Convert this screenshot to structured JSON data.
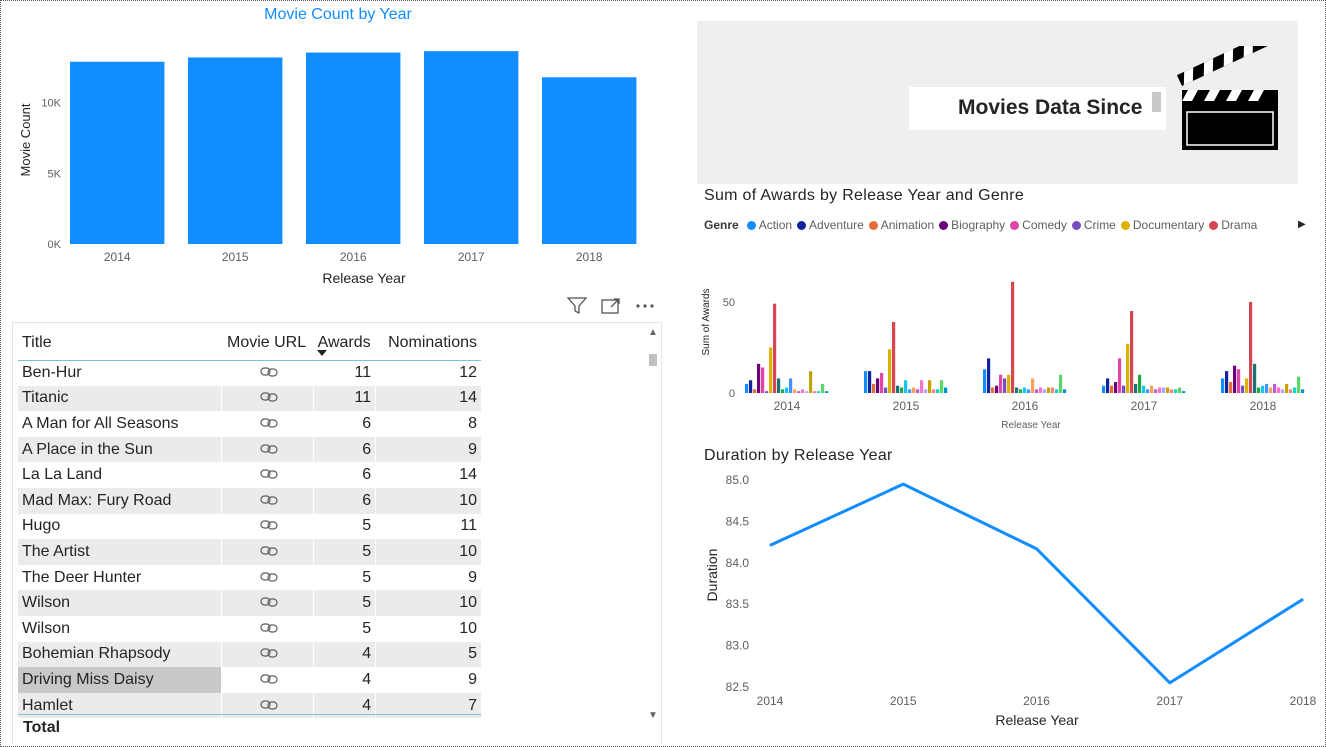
{
  "bar_chart": {
    "title": "Movie Count by Year",
    "xlabel": "Release Year",
    "ylabel": "Movie Count",
    "accent": "#118dff"
  },
  "banner": {
    "text": "Movies Data Since",
    "icon": "clapperboard-icon"
  },
  "awards_chart": {
    "title": "Sum of Awards by Release Year and Genre",
    "legend_label": "Genre",
    "ylabel": "Sum of Awards",
    "xlabel": "Release Year"
  },
  "line_chart": {
    "title": "Duration by Release Year",
    "xlabel": "Release Year",
    "ylabel": "Duration",
    "accent": "#118dff"
  },
  "visual_header": {
    "icons": [
      "filter-icon",
      "focus-mode-icon",
      "more-options-icon"
    ]
  },
  "table": {
    "headers": [
      "Title",
      "Movie URL",
      "Awards",
      "Nominations"
    ],
    "rows": [
      {
        "title": "Ben-Hur",
        "awards": "11",
        "nominations": "12"
      },
      {
        "title": "Titanic",
        "awards": "11",
        "nominations": "14"
      },
      {
        "title": "A Man for All Seasons",
        "awards": "6",
        "nominations": "8"
      },
      {
        "title": "A Place in the Sun",
        "awards": "6",
        "nominations": "9"
      },
      {
        "title": "La La Land",
        "awards": "6",
        "nominations": "14"
      },
      {
        "title": "Mad Max: Fury Road",
        "awards": "6",
        "nominations": "10"
      },
      {
        "title": "Hugo",
        "awards": "5",
        "nominations": "11"
      },
      {
        "title": "The Artist",
        "awards": "5",
        "nominations": "10"
      },
      {
        "title": "The Deer Hunter",
        "awards": "5",
        "nominations": "9"
      },
      {
        "title": "Wilson",
        "awards": "5",
        "nominations": "10"
      },
      {
        "title": "Wilson",
        "awards": "5",
        "nominations": "10"
      },
      {
        "title": "Bohemian Rhapsody",
        "awards": "4",
        "nominations": "5"
      },
      {
        "title": "Driving Miss Daisy",
        "awards": "4",
        "nominations": "9"
      },
      {
        "title": "Hamlet",
        "awards": "4",
        "nominations": "7"
      }
    ],
    "url_icon": "link-icon",
    "total_label": "Total",
    "selected_row": 12
  },
  "chart_data": [
    {
      "type": "bar",
      "title": "Movie Count by Year",
      "xlabel": "Release Year",
      "ylabel": "Movie Count",
      "categories": [
        "2014",
        "2015",
        "2016",
        "2017",
        "2018"
      ],
      "values": [
        12900,
        13200,
        13550,
        13650,
        11800
      ],
      "yticks": [
        "0K",
        "5K",
        "10K"
      ],
      "ylim": [
        0,
        15500
      ],
      "grid": false
    },
    {
      "type": "bar",
      "title": "Sum of Awards by Release Year and Genre",
      "xlabel": "Release Year",
      "ylabel": "Sum of Awards",
      "categories": [
        "2014",
        "2015",
        "2016",
        "2017",
        "2018"
      ],
      "yticks": [
        "0",
        "50"
      ],
      "ylim": [
        0,
        62
      ],
      "legend_position": "top-left",
      "series": [
        {
          "name": "Action",
          "color": "#118dff",
          "values": [
            5,
            12,
            13,
            4,
            8
          ]
        },
        {
          "name": "Adventure",
          "color": "#12239e",
          "values": [
            7,
            12,
            19,
            8,
            12
          ]
        },
        {
          "name": "Animation",
          "color": "#e66c37",
          "values": [
            2,
            5,
            3,
            4,
            6
          ]
        },
        {
          "name": "Biography",
          "color": "#6b007b",
          "values": [
            16,
            8,
            4,
            6,
            15
          ]
        },
        {
          "name": "Comedy",
          "color": "#e044a7",
          "values": [
            14,
            11,
            10,
            19,
            13
          ]
        },
        {
          "name": "Crime",
          "color": "#744ec2",
          "values": [
            1,
            3,
            8,
            4,
            4
          ]
        },
        {
          "name": "Documentary",
          "color": "#d9b300",
          "values": [
            25,
            24,
            10,
            27,
            8
          ]
        },
        {
          "name": "Drama",
          "color": "#d64550",
          "values": [
            49,
            39,
            61,
            45,
            50
          ]
        },
        {
          "name": "",
          "color": "#197278",
          "values": [
            8,
            4,
            3,
            5,
            16
          ]
        },
        {
          "name": "",
          "color": "#1aab40",
          "values": [
            2,
            3,
            2,
            10,
            3
          ]
        },
        {
          "name": "",
          "color": "#15c6f4",
          "values": [
            3,
            7,
            3,
            4,
            4
          ]
        },
        {
          "name": "",
          "color": "#4092ff",
          "values": [
            8,
            2,
            2,
            2,
            5
          ]
        },
        {
          "name": "",
          "color": "#ffa058",
          "values": [
            2,
            3,
            8,
            4,
            3
          ]
        },
        {
          "name": "",
          "color": "#be5dc9",
          "values": [
            1,
            2,
            2,
            2,
            5
          ]
        },
        {
          "name": "",
          "color": "#f472d0",
          "values": [
            2,
            7,
            3,
            3,
            3
          ]
        },
        {
          "name": "",
          "color": "#b5a1ff",
          "values": [
            1,
            2,
            2,
            3,
            2
          ]
        },
        {
          "name": "",
          "color": "#c4a200",
          "values": [
            12,
            7,
            3,
            3,
            5
          ]
        },
        {
          "name": "",
          "color": "#ff8080",
          "values": [
            1,
            2,
            3,
            2,
            2
          ]
        },
        {
          "name": "",
          "color": "#00dbbc",
          "values": [
            1,
            2,
            2,
            2,
            3
          ]
        },
        {
          "name": "",
          "color": "#5bd667",
          "values": [
            5,
            7,
            10,
            3,
            9
          ]
        },
        {
          "name": "",
          "color": "#0091d5",
          "values": [
            1,
            3,
            2,
            1,
            2
          ]
        }
      ]
    },
    {
      "type": "line",
      "title": "Duration by Release Year",
      "xlabel": "Release Year",
      "ylabel": "Duration",
      "x": [
        "2014",
        "2015",
        "2016",
        "2017",
        "2018"
      ],
      "values": [
        84.21,
        84.95,
        84.17,
        82.55,
        83.56
      ],
      "yticks": [
        "82.5",
        "83.0",
        "83.5",
        "84.0",
        "84.5",
        "85.0"
      ],
      "ylim": [
        82.5,
        85.0
      ],
      "grid": false
    }
  ]
}
